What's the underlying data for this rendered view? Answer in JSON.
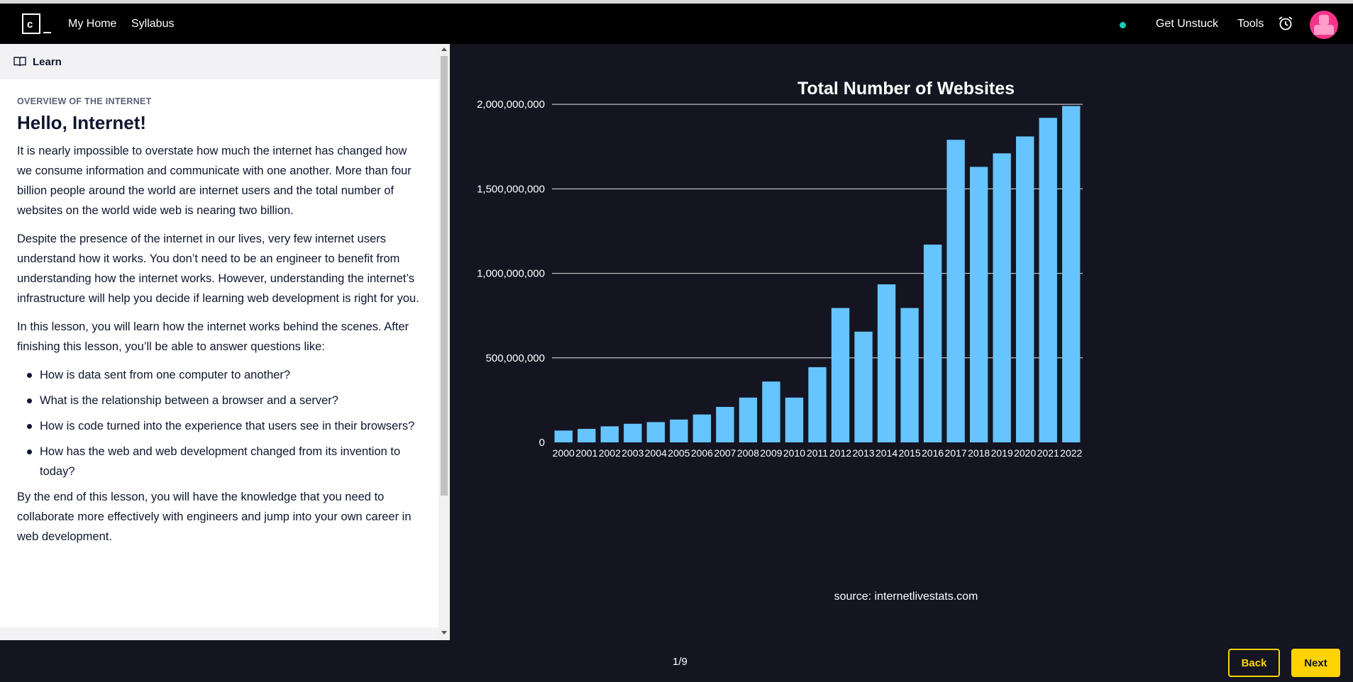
{
  "nav": {
    "logo_letter": "c",
    "my_home": "My Home",
    "syllabus": "Syllabus",
    "get_unstuck": "Get Unstuck",
    "tools": "Tools",
    "icons": [
      "logo-icon",
      "status-dot-icon",
      "alarm-clock-icon",
      "avatar"
    ]
  },
  "learn": {
    "tab_label": "Learn",
    "kicker": "OVERVIEW OF THE INTERNET",
    "title": "Hello, Internet!",
    "paragraphs": [
      "It is nearly impossible to overstate how much the internet has changed how we consume information and communicate with one another. More than four billion people around the world are internet users and the total number of websites on the world wide web is nearing two billion.",
      "Despite the presence of the internet in our lives, very few internet users understand how it works. You don’t need to be an engineer to benefit from understanding how the internet works. However, understanding the internet’s infrastructure will help you decide if learning web development is right for you.",
      "In this lesson, you will learn how the internet works behind the scenes. After finishing this lesson, you’ll be able to answer questions like:"
    ],
    "bullets": [
      "How is data sent from one computer to another?",
      "What is the relationship between a browser and a server?",
      "How is code turned into the experience that users see in their browsers?",
      "How has the web and web development changed from its invention to today?"
    ],
    "closing": "By the end of this lesson, you will have the knowledge that you need to collaborate more effectively with engineers and jump into your own career in web development."
  },
  "footer": {
    "page_count": "1/9",
    "back": "Back",
    "next": "Next"
  },
  "colors": {
    "bar": "#66c4ff",
    "accent": "#ffd300",
    "background": "#141521"
  },
  "chart_data": {
    "type": "bar",
    "title": "Total Number of Websites",
    "source": "source: internetlivestats.com",
    "categories": [
      "2000",
      "2001",
      "2002",
      "2003",
      "2004",
      "2005",
      "2006",
      "2007",
      "2008",
      "2009",
      "2010",
      "2011",
      "2012",
      "2013",
      "2014",
      "2015",
      "2016",
      "2017",
      "2018",
      "2019",
      "2020",
      "2021",
      "2022"
    ],
    "values": [
      70000000,
      80000000,
      95000000,
      110000000,
      120000000,
      135000000,
      165000000,
      210000000,
      265000000,
      360000000,
      265000000,
      445000000,
      795000000,
      655000000,
      935000000,
      795000000,
      1170000000,
      1790000000,
      1630000000,
      1710000000,
      1810000000,
      1920000000,
      1990000000
    ],
    "yticks": [
      0,
      500000000,
      1000000000,
      1500000000,
      2000000000
    ],
    "ytick_labels": [
      "0",
      "500,000,000",
      "1,000,000,000",
      "1,500,000,000",
      "2,000,000,000"
    ],
    "ylim": [
      0,
      2030000000
    ],
    "grid": true
  }
}
